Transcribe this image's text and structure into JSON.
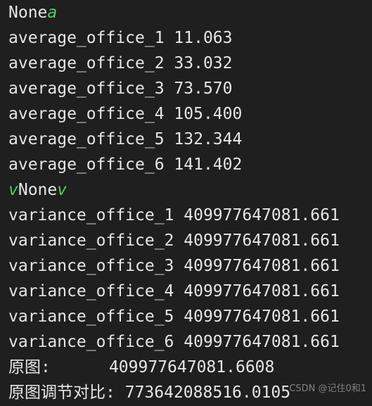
{
  "terminal": {
    "line0": {
      "prefix": "None",
      "suffix": "a"
    },
    "averages": [
      {
        "label": "average_office_1",
        "value": "11.063"
      },
      {
        "label": "average_office_2",
        "value": "33.032"
      },
      {
        "label": "average_office_3",
        "value": "73.570"
      },
      {
        "label": "average_office_4",
        "value": "105.400"
      },
      {
        "label": "average_office_5",
        "value": "132.344"
      },
      {
        "label": "average_office_6",
        "value": "141.402"
      }
    ],
    "line7": {
      "prefix": "v",
      "middle": "None",
      "suffix": "v"
    },
    "variances": [
      {
        "label": "variance_office_1",
        "value": "409977647081.661"
      },
      {
        "label": "variance_office_2",
        "value": "409977647081.661"
      },
      {
        "label": "variance_office_3",
        "value": "409977647081.661"
      },
      {
        "label": "variance_office_4",
        "value": "409977647081.661"
      },
      {
        "label": "variance_office_5",
        "value": "409977647081.661"
      },
      {
        "label": "variance_office_6",
        "value": "409977647081.661"
      }
    ],
    "original_label": "原图:",
    "original_value": "409977647081.6608",
    "adjusted_label": "原图调节对比:",
    "adjusted_value": "773642088516.0105"
  },
  "watermark": "CSDN @记住0和1"
}
